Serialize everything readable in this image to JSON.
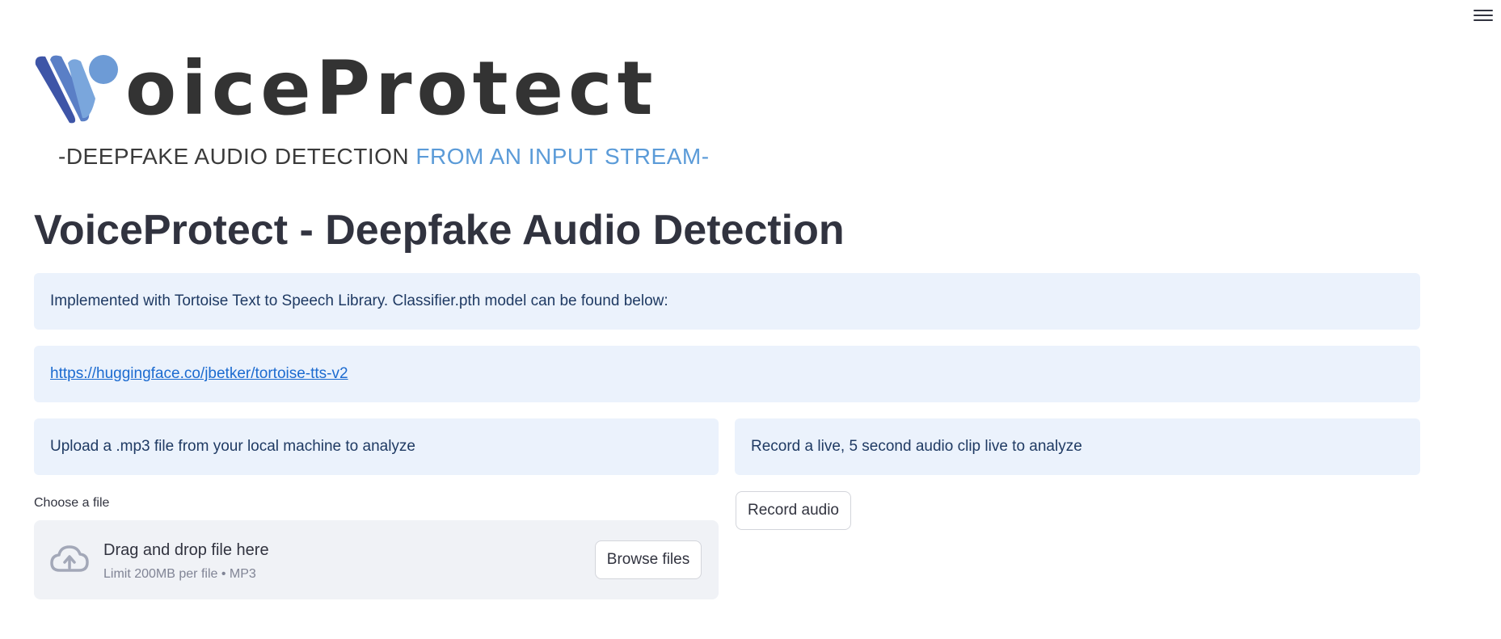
{
  "logo": {
    "wordmark": "oiceProtect",
    "tagline_dark": "-DEEPFAKE AUDIO DETECTION ",
    "tagline_blue": "FROM AN INPUT STREAM-",
    "colors": {
      "dark": "#333333",
      "blue": "#5b9bd8",
      "mark_dark": "#3e55a7",
      "mark_light": "#6d9bd6"
    }
  },
  "title": "VoiceProtect - Deepfake Audio Detection",
  "info_intro": "Implemented with Tortoise Text to Speech Library. Classifier.pth model can be found below:",
  "info_link": "https://huggingface.co/jbetker/tortoise-tts-v2",
  "upload": {
    "info": "Upload a .mp3 file from your local machine to analyze",
    "label": "Choose a file",
    "drag_text": "Drag and drop file here",
    "limit_text": "Limit 200MB per file • MP3",
    "browse_label": "Browse files",
    "icon": "cloud-upload-icon"
  },
  "record": {
    "info": "Record a live, 5 second audio clip live to analyze",
    "button_label": "Record audio"
  },
  "menu": {
    "icon": "hamburger-menu-icon"
  },
  "colors": {
    "info_bg": "#ebf2fc",
    "info_text": "#1f3a63",
    "link": "#1c6bd0",
    "dropzone_bg": "#f0f2f6"
  }
}
